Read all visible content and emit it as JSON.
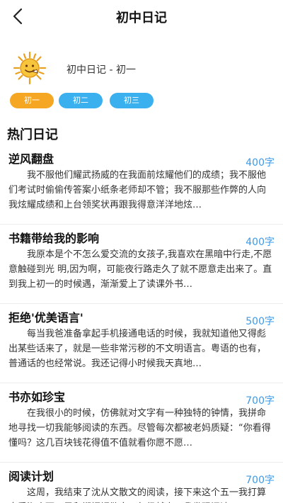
{
  "header": {
    "title": "初中日记"
  },
  "profile": {
    "name": "初中日记 - 初一"
  },
  "grades": [
    {
      "label": "初一",
      "color": "#f5a623"
    },
    {
      "label": "初二",
      "color": "#3bb0ee"
    },
    {
      "label": "初三",
      "color": "#3bb0ee"
    }
  ],
  "section": {
    "title": "热门日记"
  },
  "entries": [
    {
      "title": "逆风翻盘",
      "count": "400字",
      "excerpt": "我不服他们耀武扬威的在我面前炫耀他们的成绩；我不服他们考试时偷偷传答案小纸条老师却不管；我不服那些作弊的人向我炫耀成绩和上台领奖状再跟我得意洋洋地炫…"
    },
    {
      "title": "书籍带给我的影响",
      "count": "400字",
      "excerpt": "我原本是个不怎么爱交流的女孩子,我喜欢在黑暗中行走,不愿意触碰到光 明,因为啊，可能夜行路走久了就不愿意走出来了。直到我上初一的时候遇，渐渐爱上了读课外书…"
    },
    {
      "title": "拒绝'优美语言'",
      "count": "500字",
      "excerpt": "每当我爸准备拿起手机接通电话的时候，我就知道他又得彪出某些话来了，就是一些非常污秽的不文明语言。粤语的也有，普通话的也经常说。我还记得小时候我天真地…"
    },
    {
      "title": "书亦如珍宝",
      "count": "700字",
      "excerpt": "在我很小的时候，仿佛就对文字有一种独特的钟情，我拼命地寻找一切我能够阅读的东西。尽管每次都被老妈质疑：“你看得懂吗？这几百块钱花得值不值就看你愿不愿…"
    },
    {
      "title": "阅读计划",
      "count": "700字",
      "excerpt": "这周，我结束了沈从文散文的阅读，接下来这个五一我打算去看海底两万里和郑振铎散文，年级越高，我发现阅读…"
    }
  ]
}
